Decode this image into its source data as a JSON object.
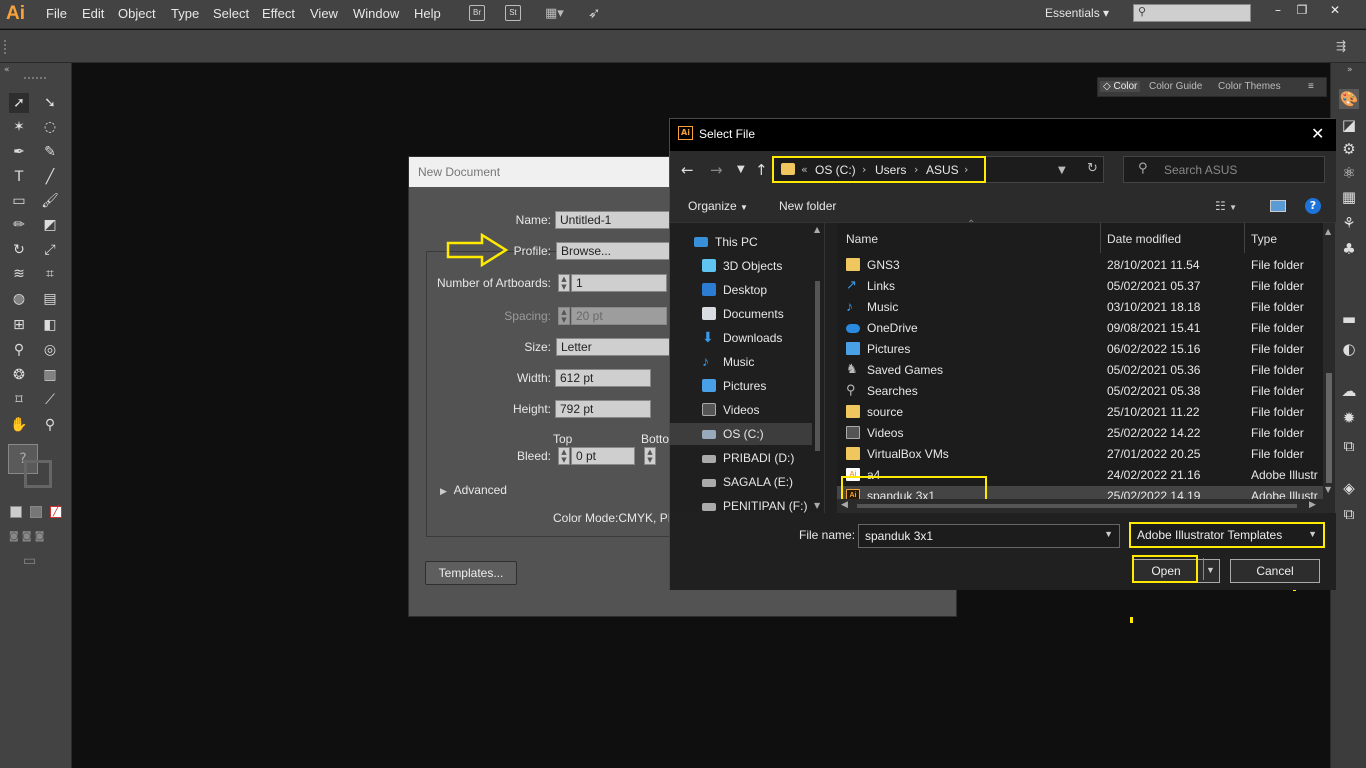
{
  "app": {
    "logo": "Ai",
    "menu": [
      "File",
      "Edit",
      "Object",
      "Type",
      "Select",
      "Effect",
      "View",
      "Window",
      "Help"
    ],
    "bridge_icon": "Br",
    "stock_icon": "St",
    "workspace": "Essentials",
    "accent": "#f7a23a",
    "highlight": "#ffea00"
  },
  "color_panel": {
    "tabs": [
      "Color",
      "Color Guide",
      "Color Themes"
    ]
  },
  "new_document": {
    "title": "New Document",
    "name_label": "Name:",
    "name_value": "Untitled-1",
    "profile_label": "Profile:",
    "profile_value": "Browse...",
    "artboards_label": "Number of Artboards:",
    "artboards_value": "1",
    "spacing_label": "Spacing:",
    "spacing_value": "20 pt",
    "size_label": "Size:",
    "size_value": "Letter",
    "width_label": "Width:",
    "width_value": "612 pt",
    "height_label": "Height:",
    "height_value": "792 pt",
    "bleed_label": "Bleed:",
    "bleed_top_label": "Top",
    "bleed_top_value": "0 pt",
    "bleed_bottom_label": "Botto",
    "advanced_label": "Advanced",
    "color_mode": "Color Mode:CMYK, PP",
    "templates_button": "Templates..."
  },
  "select_file": {
    "title": "Select File",
    "breadcrumb": [
      "OS (C:)",
      "Users",
      "ASUS"
    ],
    "search_placeholder": "Search ASUS",
    "organize": "Organize",
    "new_folder": "New folder",
    "tree": [
      {
        "label": "This PC",
        "icon": "pc-icon"
      },
      {
        "label": "3D Objects",
        "icon": "cube-icon"
      },
      {
        "label": "Desktop",
        "icon": "desktop-icon"
      },
      {
        "label": "Documents",
        "icon": "documents-icon"
      },
      {
        "label": "Downloads",
        "icon": "download-icon"
      },
      {
        "label": "Music",
        "icon": "music-icon"
      },
      {
        "label": "Pictures",
        "icon": "pictures-icon"
      },
      {
        "label": "Videos",
        "icon": "videos-icon"
      },
      {
        "label": "OS (C:)",
        "icon": "drive-icon"
      },
      {
        "label": "PRIBADI (D:)",
        "icon": "drive-icon"
      },
      {
        "label": "SAGALA (E:)",
        "icon": "drive-icon"
      },
      {
        "label": "PENITIPAN (F:)",
        "icon": "drive-icon"
      }
    ],
    "columns": {
      "name": "Name",
      "date": "Date modified",
      "type": "Type"
    },
    "files": [
      {
        "name": "GNS3",
        "date": "28/10/2021 11.54",
        "type": "File folder",
        "icon": "folder-icon"
      },
      {
        "name": "Links",
        "date": "05/02/2021 05.37",
        "type": "File folder",
        "icon": "link-icon"
      },
      {
        "name": "Music",
        "date": "03/10/2021 18.18",
        "type": "File folder",
        "icon": "music-icon"
      },
      {
        "name": "OneDrive",
        "date": "09/08/2021 15.41",
        "type": "File folder",
        "icon": "cloud-icon"
      },
      {
        "name": "Pictures",
        "date": "06/02/2022 15.16",
        "type": "File folder",
        "icon": "pictures-icon"
      },
      {
        "name": "Saved Games",
        "date": "05/02/2021 05.36",
        "type": "File folder",
        "icon": "games-icon"
      },
      {
        "name": "Searches",
        "date": "05/02/2021 05.38",
        "type": "File folder",
        "icon": "search-icon"
      },
      {
        "name": "source",
        "date": "25/10/2021 11.22",
        "type": "File folder",
        "icon": "folder-icon"
      },
      {
        "name": "Videos",
        "date": "25/02/2022 14.22",
        "type": "File folder",
        "icon": "videos-icon"
      },
      {
        "name": "VirtualBox VMs",
        "date": "27/01/2022 20.25",
        "type": "File folder",
        "icon": "folder-icon"
      },
      {
        "name": "a4",
        "date": "24/02/2022 21.16",
        "type": "Adobe Illustr",
        "icon": "ai-file-icon"
      },
      {
        "name": "spanduk 3x1",
        "date": "25/02/2022 14.19",
        "type": "Adobe Illustr",
        "icon": "ai-file-icon"
      }
    ],
    "file_name_label": "File name:",
    "file_name_value": "spanduk 3x1",
    "file_type": "Adobe Illustrator Templates",
    "open_button": "Open",
    "cancel_button": "Cancel"
  }
}
